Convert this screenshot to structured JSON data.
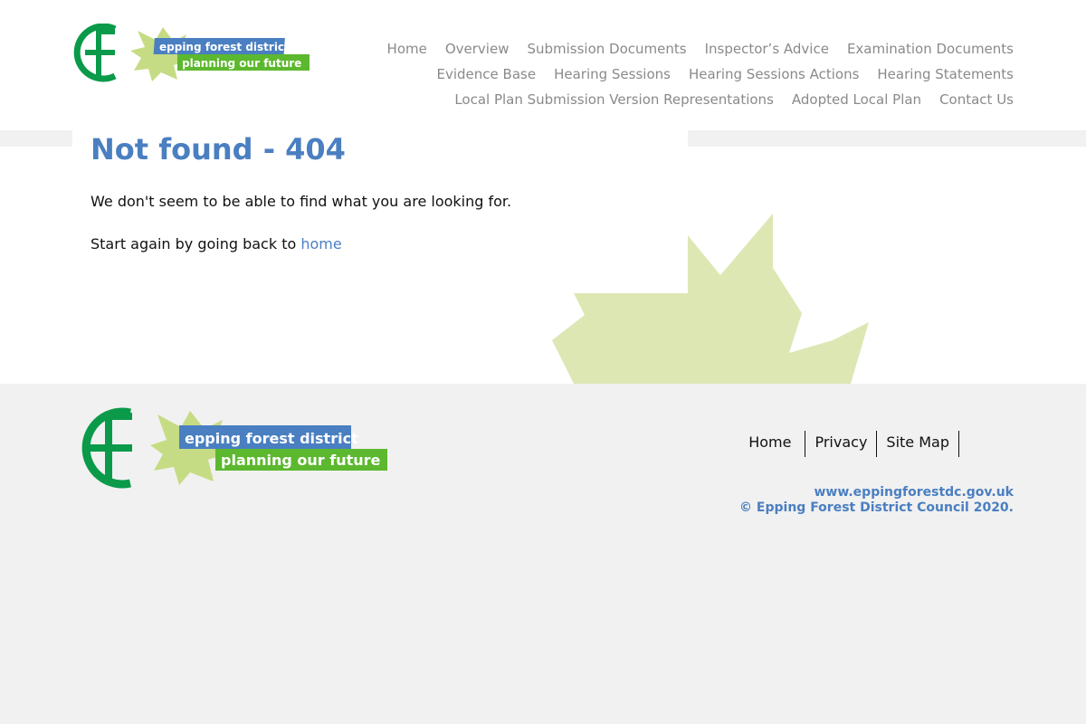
{
  "brand": {
    "logo_line1": "epping forest district",
    "logo_line2": "planning our future",
    "colors": {
      "green": "#0a9a4a",
      "leaf": "#c6dc84",
      "blue": "#4a7fc1",
      "lime": "#5cb82e"
    }
  },
  "nav": {
    "row1": [
      "Home",
      "Overview",
      "Submission Documents",
      "Inspector’s Advice",
      "Examination Documents"
    ],
    "row2": [
      "Evidence Base",
      "Hearing Sessions",
      "Hearing Sessions Actions",
      "Hearing Statements"
    ],
    "row3": [
      "Local Plan Submission Version Representations",
      "Adopted Local Plan",
      "Contact Us"
    ]
  },
  "main": {
    "title": "Not found - 404",
    "message": "We don't seem to be able to find what you are looking for.",
    "restart_prefix": "Start again by going back to ",
    "restart_link": "home"
  },
  "footer": {
    "links": [
      "Home",
      "Privacy",
      "Site Map"
    ],
    "website": "www.eppingforestdc.gov.uk",
    "copyright": "© Epping Forest District Council 2020."
  }
}
